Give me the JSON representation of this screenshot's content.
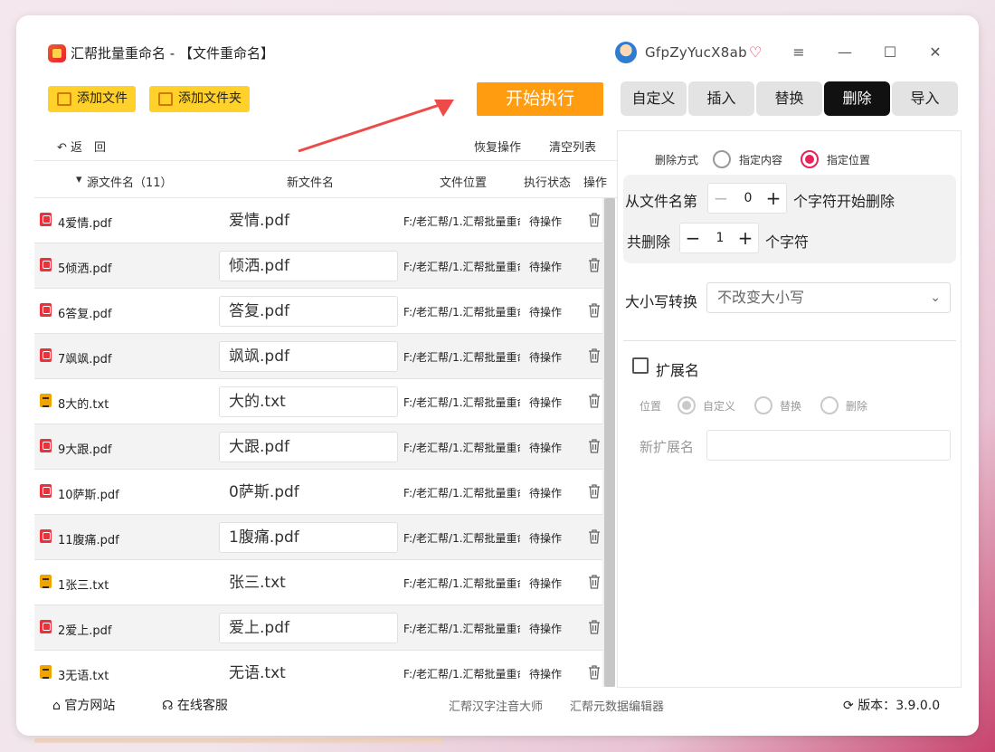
{
  "app": {
    "title": "汇帮批量重命名 - 【文件重命名】"
  },
  "user": {
    "name": "GfpZyYucX8ab"
  },
  "window_controls": {
    "menu": "≡",
    "minimize": "—",
    "maximize": "☐",
    "close": "✕"
  },
  "toolbar": {
    "add_file": "添加文件",
    "add_folder": "添加文件夹",
    "start": "开始执行",
    "tabs": [
      "自定义",
      "插入",
      "替换",
      "删除",
      "导入"
    ],
    "active_tab": "删除"
  },
  "list": {
    "back": "返　回",
    "restore": "恢复操作",
    "clear": "清空列表",
    "columns": {
      "source": "源文件名（11）",
      "new_name": "新文件名",
      "location": "文件位置",
      "status": "执行状态",
      "action": "操作"
    },
    "rows": [
      {
        "icon": "pdf-icon",
        "source": "4爱情.pdf",
        "new_name": "爱情.pdf",
        "location": "F:/老汇帮/1.汇帮批量重命名",
        "status": "待操作"
      },
      {
        "icon": "pdf-icon",
        "source": "5倾洒.pdf",
        "new_name": "倾洒.pdf",
        "location": "F:/老汇帮/1.汇帮批量重命名",
        "status": "待操作"
      },
      {
        "icon": "pdf-icon",
        "source": "6答复.pdf",
        "new_name": "答复.pdf",
        "location": "F:/老汇帮/1.汇帮批量重命名",
        "status": "待操作"
      },
      {
        "icon": "pdf-icon",
        "source": "7飒飒.pdf",
        "new_name": "飒飒.pdf",
        "location": "F:/老汇帮/1.汇帮批量重命名",
        "status": "待操作"
      },
      {
        "icon": "txt-icon",
        "source": "8大的.txt",
        "new_name": "大的.txt",
        "location": "F:/老汇帮/1.汇帮批量重命名",
        "status": "待操作"
      },
      {
        "icon": "pdf-icon",
        "source": "9大跟.pdf",
        "new_name": "大跟.pdf",
        "location": "F:/老汇帮/1.汇帮批量重命名",
        "status": "待操作"
      },
      {
        "icon": "pdf-icon",
        "source": "10萨斯.pdf",
        "new_name": "0萨斯.pdf",
        "location": "F:/老汇帮/1.汇帮批量重命名",
        "status": "待操作"
      },
      {
        "icon": "pdf-icon",
        "source": "11腹痛.pdf",
        "new_name": "1腹痛.pdf",
        "location": "F:/老汇帮/1.汇帮批量重命名",
        "status": "待操作"
      },
      {
        "icon": "txt-icon",
        "source": "1张三.txt",
        "new_name": "张三.txt",
        "location": "F:/老汇帮/1.汇帮批量重命名",
        "status": "待操作"
      },
      {
        "icon": "pdf-icon",
        "source": "2爱上.pdf",
        "new_name": "爱上.pdf",
        "location": "F:/老汇帮/1.汇帮批量重命名",
        "status": "待操作"
      },
      {
        "icon": "txt-icon",
        "source": "3无语.txt",
        "new_name": "无语.txt",
        "location": "F:/老汇帮/1.汇帮批量重命名",
        "status": "待操作"
      }
    ]
  },
  "panel": {
    "delete_mode_label": "删除方式",
    "mode_content": "指定内容",
    "mode_position": "指定位置",
    "mode_selected": "指定位置",
    "from_label": "从文件名第",
    "from_value": "0",
    "from_suffix": "个字符开始删除",
    "count_label": "共删除",
    "count_value": "1",
    "count_suffix": "个字符",
    "case_label": "大小写转换",
    "case_value": "不改变大小写",
    "ext_label": "扩展名",
    "ext_checked": false,
    "pos_label": "位置",
    "pos_custom": "自定义",
    "pos_replace": "替换",
    "pos_delete": "删除",
    "new_ext_label": "新扩展名",
    "new_ext_value": ""
  },
  "footer": {
    "website": "官方网站",
    "support": "在线客服",
    "pinyin": "汇帮汉字注音大师",
    "metadata": "汇帮元数据编辑器",
    "version_label": "版本：",
    "version": "3.9.0.0"
  },
  "colors": {
    "accent": "#ff9c0f",
    "toolbar_yellow": "#ffd12a",
    "radio_on": "#e8225a",
    "active_tab": "#111111"
  }
}
